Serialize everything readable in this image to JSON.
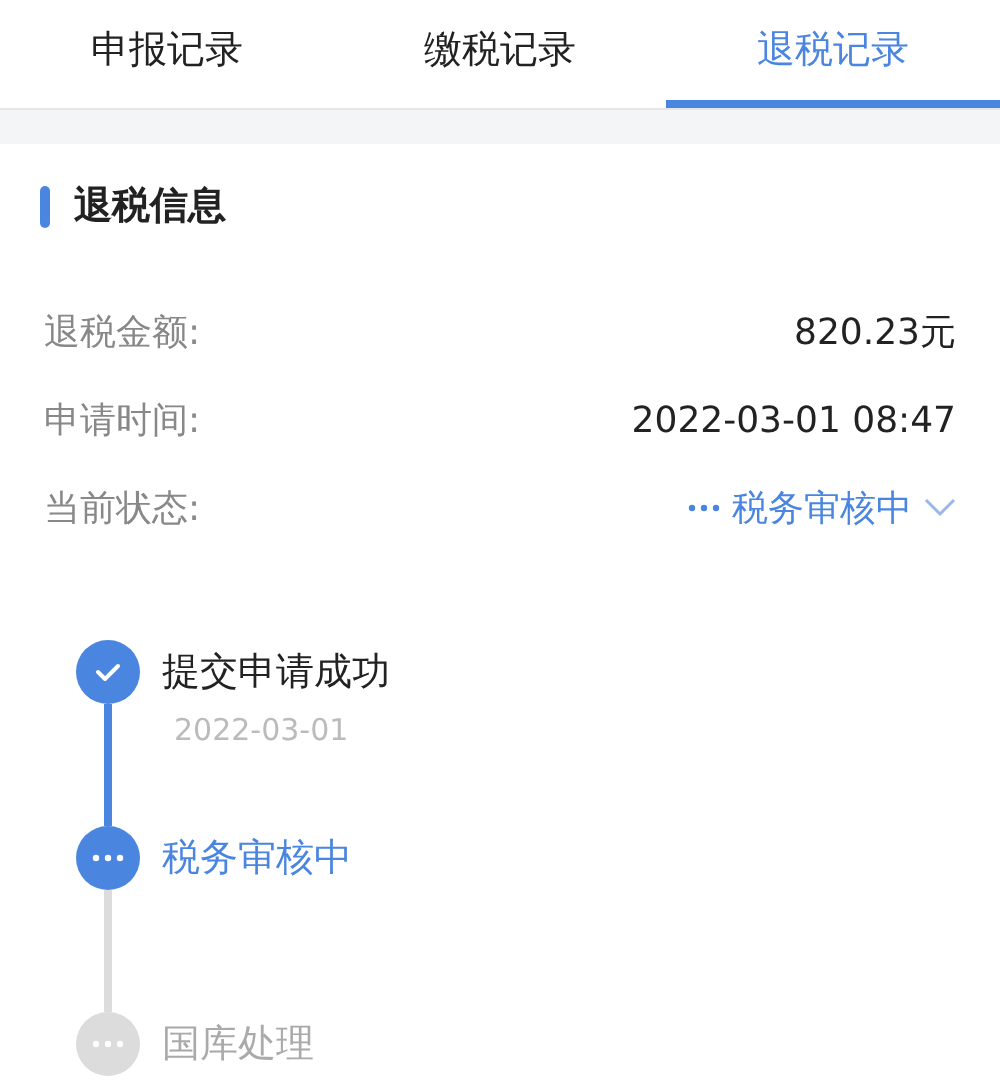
{
  "tabs": [
    {
      "label": "申报记录",
      "selected": false
    },
    {
      "label": "缴税记录",
      "selected": false
    },
    {
      "label": "退税记录",
      "selected": true
    }
  ],
  "section": {
    "title": "退税信息"
  },
  "fields": [
    {
      "label": "退税金额:",
      "value": "820.23元",
      "kind": "text"
    },
    {
      "label": "申请时间:",
      "value": "2022-03-01 08:47",
      "kind": "text"
    },
    {
      "label": "当前状态:",
      "value": "税务审核中",
      "kind": "status"
    }
  ],
  "steps": [
    {
      "title": "提交申请成功",
      "date": "2022-03-01",
      "kind": "done"
    },
    {
      "title": "税务审核中",
      "kind": "current"
    },
    {
      "title": "国库处理",
      "kind": "pending"
    }
  ]
}
